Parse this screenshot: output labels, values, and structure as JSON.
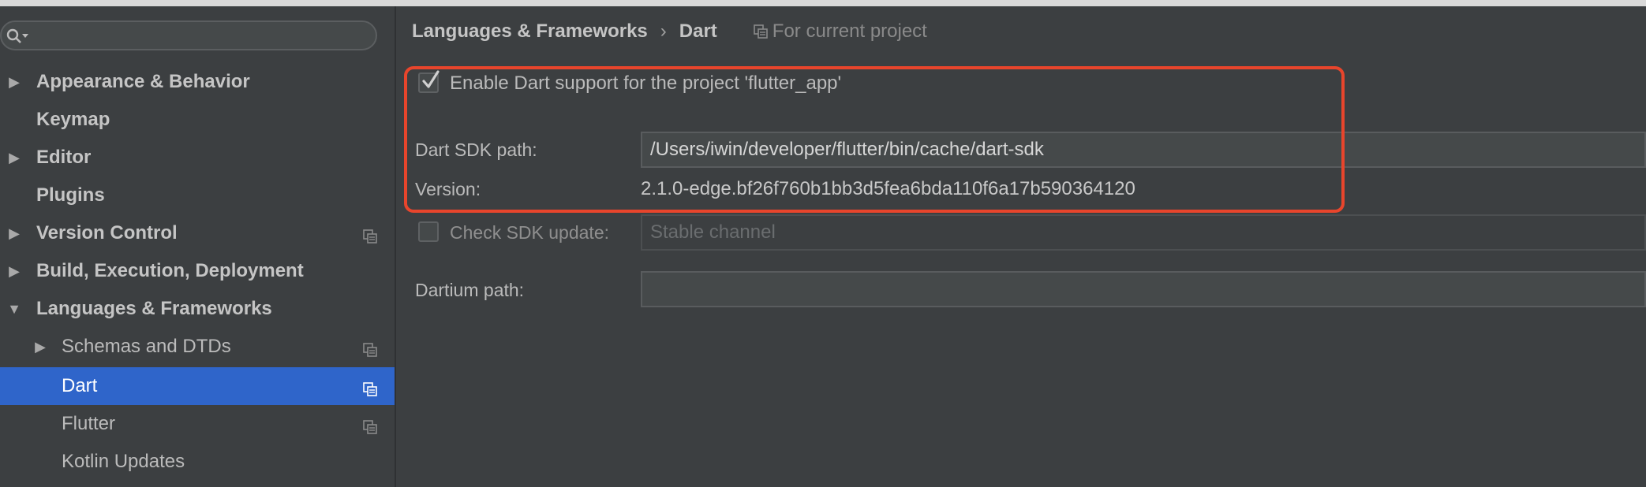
{
  "sidebar": {
    "search_placeholder": "",
    "items": [
      {
        "label": "Appearance & Behavior"
      },
      {
        "label": "Keymap"
      },
      {
        "label": "Editor"
      },
      {
        "label": "Plugins"
      },
      {
        "label": "Version Control"
      },
      {
        "label": "Build, Execution, Deployment"
      },
      {
        "label": "Languages & Frameworks"
      },
      {
        "label": "Schemas and DTDs"
      },
      {
        "label": "Dart"
      },
      {
        "label": "Flutter"
      },
      {
        "label": "Kotlin Updates"
      }
    ]
  },
  "breadcrumb": {
    "parent": "Languages & Frameworks",
    "separator": "›",
    "current": "Dart",
    "scope": "For current project"
  },
  "settings": {
    "enable_label": "Enable Dart support for the project 'flutter_app'",
    "enable_checked": true,
    "sdk_path_label": "Dart SDK path:",
    "sdk_path_value": "/Users/iwin/developer/flutter/bin/cache/dart-sdk",
    "version_label": "Version:",
    "version_value": "2.1.0-edge.bf26f760b1bb3d5fea6bda110f6a17b590364120",
    "check_update_label": "Check SDK update:",
    "check_update_checked": false,
    "channel_value": "Stable channel",
    "dartium_label": "Dartium path:",
    "dartium_value": ""
  },
  "colors": {
    "background": "#3c3f41",
    "selection": "#2f65ca",
    "highlight_box": "#e8452c"
  }
}
